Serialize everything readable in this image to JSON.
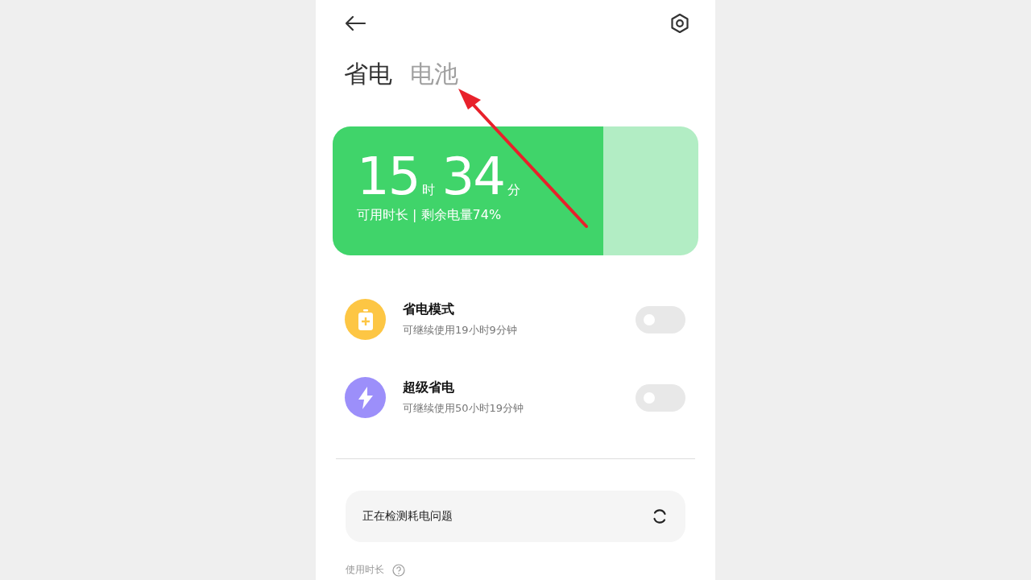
{
  "tabs": [
    {
      "label": "省电",
      "selected": true
    },
    {
      "label": "电池",
      "selected": false
    }
  ],
  "battery": {
    "hours": "15",
    "hours_unit": "时",
    "minutes": "34",
    "minutes_unit": "分",
    "caption": "可用时长 | 剩余电量74%",
    "level": 0.74
  },
  "modes": [
    {
      "kind": "battery",
      "title": "省电模式",
      "subtitle": "可继续使用19小时9分钟",
      "color": "#fdc644",
      "on": false
    },
    {
      "kind": "bolt",
      "title": "超级省电",
      "subtitle": "可继续使用50小时19分钟",
      "color": "#9c8ffa",
      "on": false
    }
  ],
  "detect": {
    "label": "正在检测耗电问题"
  },
  "section": {
    "label": "使用时长"
  }
}
